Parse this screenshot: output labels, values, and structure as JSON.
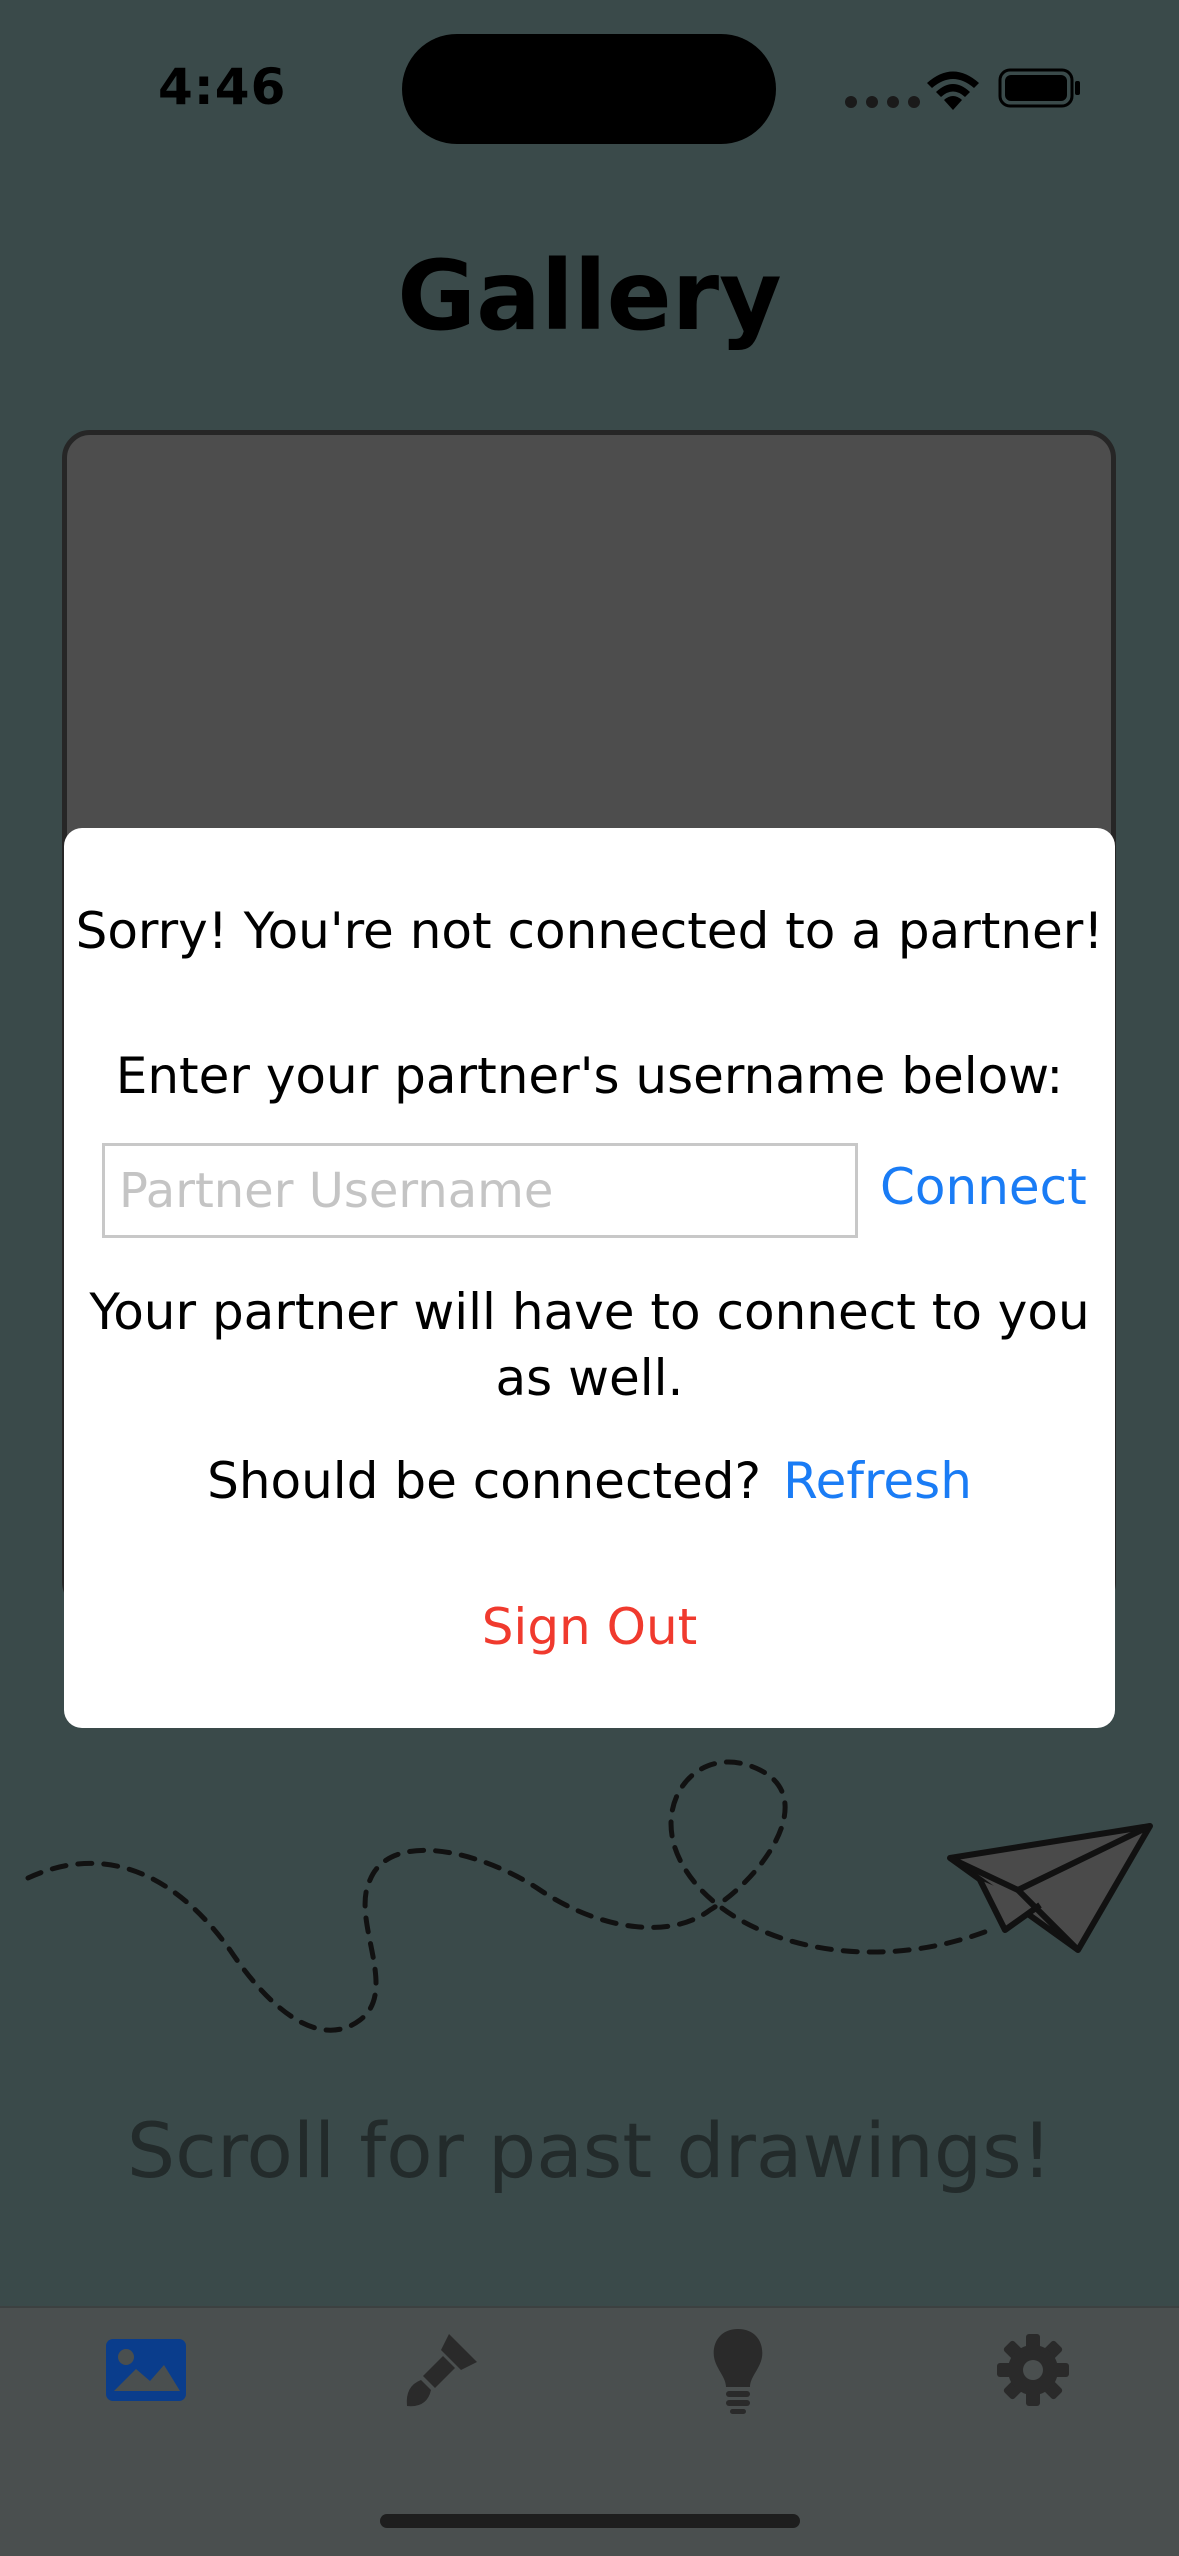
{
  "status_bar": {
    "time": "4:46"
  },
  "header": {
    "title": "Gallery"
  },
  "modal": {
    "message": "Sorry! You're not connected to a partner!",
    "prompt": "Enter your partner's username below:",
    "input": {
      "placeholder": "Partner Username",
      "value": ""
    },
    "connect_label": "Connect",
    "note_line1": "Your partner will have to connect to you",
    "note_line2": "as well.",
    "refresh_question": "Should be connected?",
    "refresh_label": "Refresh",
    "signout_label": "Sign Out"
  },
  "scroll_hint": "Scroll for past drawings!",
  "tabs": [
    {
      "icon": "photo-icon",
      "selected": true
    },
    {
      "icon": "paintbrush-icon",
      "selected": false
    },
    {
      "icon": "lightbulb-icon",
      "selected": false
    },
    {
      "icon": "gear-icon",
      "selected": false
    }
  ],
  "colors": {
    "background": "#3a4a4a",
    "accent": "#1a7cf5",
    "destructive": "#f03a2e",
    "selected_tab": "#0a3d8c",
    "unselected_tab": "#2a2a2a"
  }
}
